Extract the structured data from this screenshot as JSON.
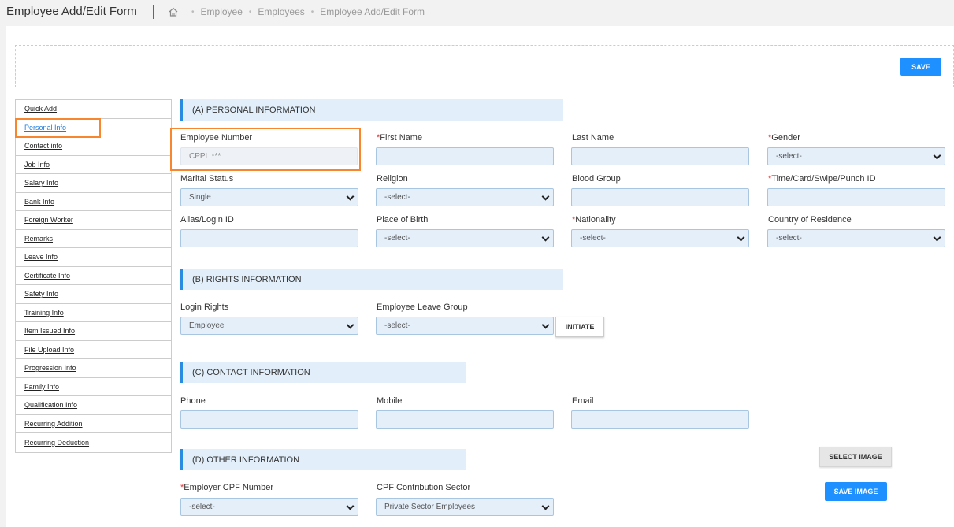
{
  "header": {
    "title": "Employee Add/Edit Form",
    "breadcrumb": [
      "Employee",
      "Employees",
      "Employee Add/Edit Form"
    ]
  },
  "toolbar": {
    "save_label": "SAVE"
  },
  "sidebar": {
    "items": [
      {
        "label": "Quick Add"
      },
      {
        "label": "Personal Info"
      },
      {
        "label": "Contact info"
      },
      {
        "label": "Job Info"
      },
      {
        "label": "Salary Info"
      },
      {
        "label": "Bank Info"
      },
      {
        "label": "Foreign Worker"
      },
      {
        "label": "Remarks"
      },
      {
        "label": "Leave Info"
      },
      {
        "label": "Certificate Info"
      },
      {
        "label": "Safety Info"
      },
      {
        "label": "Training Info"
      },
      {
        "label": "Item Issued Info"
      },
      {
        "label": "File Upload Info"
      },
      {
        "label": "Progression Info"
      },
      {
        "label": "Family Info"
      },
      {
        "label": "Qualification Info"
      },
      {
        "label": "Recurring Addition"
      },
      {
        "label": "Recurring Deduction"
      }
    ]
  },
  "sections": {
    "personal": {
      "heading": "(A) PERSONAL INFORMATION",
      "employee_number": {
        "label": "Employee Number",
        "value": "CPPL ***"
      },
      "first_name": {
        "label": "First Name",
        "value": ""
      },
      "last_name": {
        "label": "Last Name",
        "value": ""
      },
      "gender": {
        "label": "Gender",
        "value": "-select-"
      },
      "marital_status": {
        "label": "Marital Status",
        "value": "Single"
      },
      "religion": {
        "label": "Religion",
        "value": "-select-"
      },
      "blood_group": {
        "label": "Blood Group",
        "value": ""
      },
      "punch_id": {
        "label": "Time/Card/Swipe/Punch ID",
        "value": ""
      },
      "alias": {
        "label": "Alias/Login ID",
        "value": ""
      },
      "place_of_birth": {
        "label": "Place of Birth",
        "value": "-select-"
      },
      "nationality": {
        "label": "Nationality",
        "value": "-select-"
      },
      "country_of_residence": {
        "label": "Country of Residence",
        "value": "-select-"
      }
    },
    "rights": {
      "heading": "(B) RIGHTS INFORMATION",
      "login_rights": {
        "label": "Login Rights",
        "value": "Employee"
      },
      "leave_group": {
        "label": "Employee Leave Group",
        "value": "-select-"
      },
      "initiate_label": "INITIATE"
    },
    "contact": {
      "heading": "(C) CONTACT INFORMATION",
      "phone": {
        "label": "Phone",
        "value": ""
      },
      "mobile": {
        "label": "Mobile",
        "value": ""
      },
      "email": {
        "label": "Email",
        "value": ""
      }
    },
    "other": {
      "heading": "(D) OTHER INFORMATION",
      "cpf_number": {
        "label": "Employer CPF Number",
        "value": "-select-"
      },
      "cpf_sector": {
        "label": "CPF Contribution Sector",
        "value": "Private Sector Employees"
      },
      "select_image_label": "SELECT IMAGE",
      "save_image_label": "SAVE IMAGE"
    }
  },
  "required_mark": "*",
  "colors": {
    "accent": "#1e90ff",
    "highlight": "#f7862f",
    "field_bg": "#e4effa"
  }
}
